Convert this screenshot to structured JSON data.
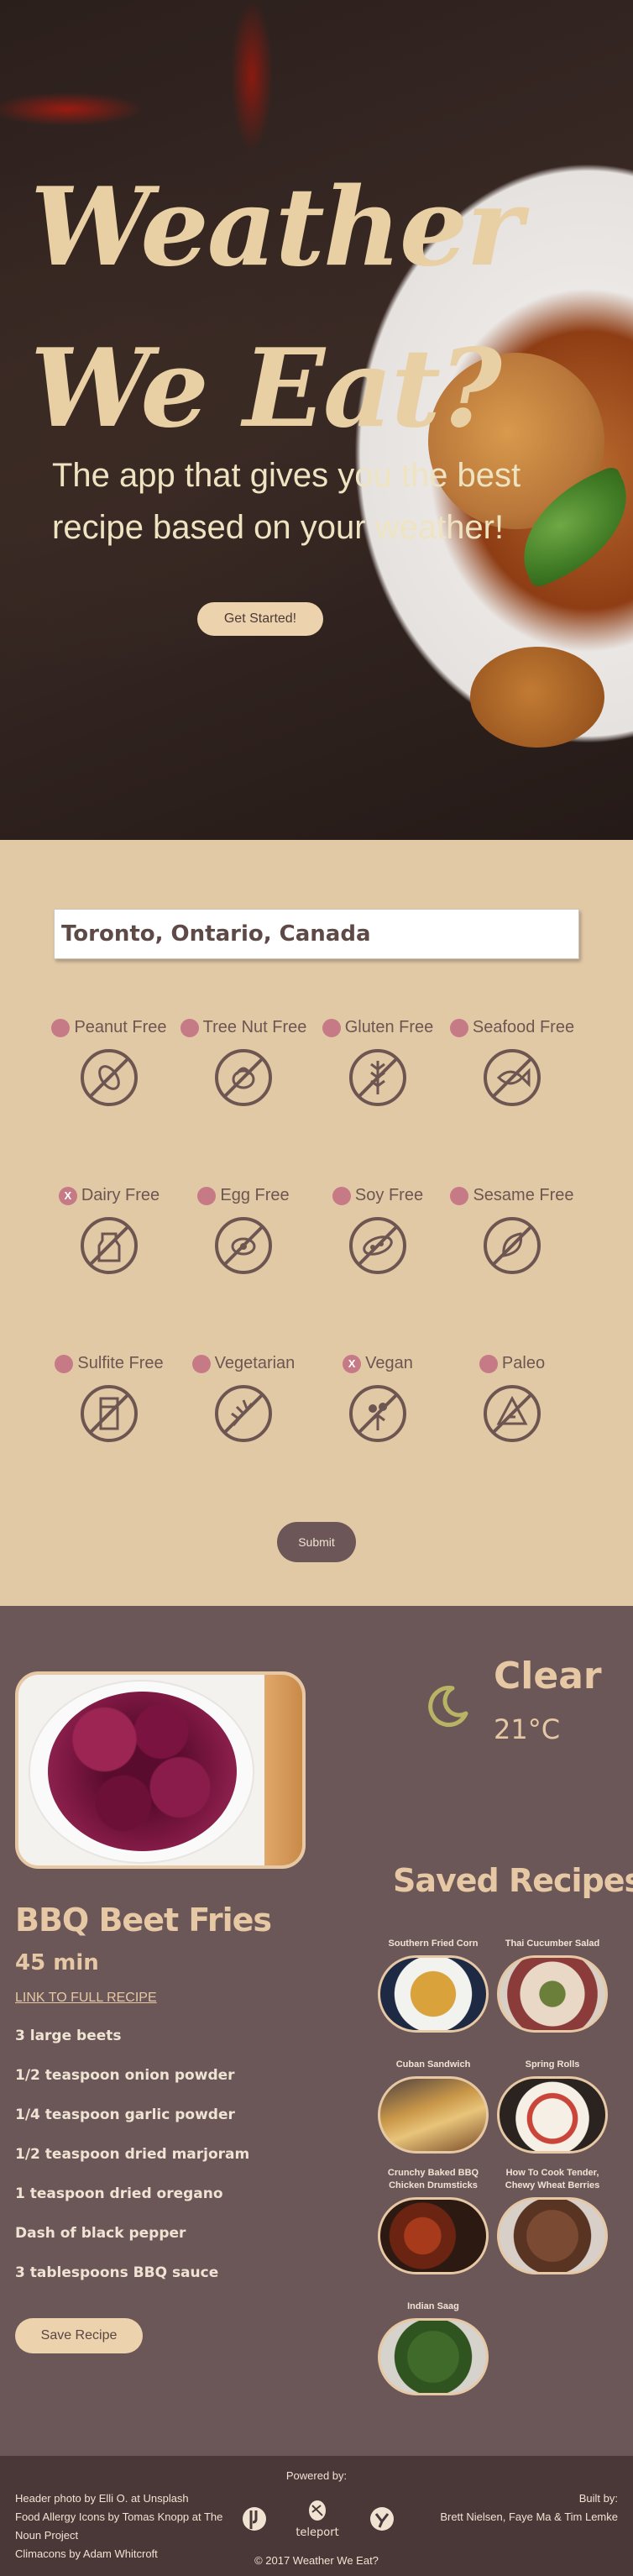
{
  "hero": {
    "title_line1": "Weather",
    "title_line2": "We Eat?",
    "subtitle": "The app that gives you the best recipe based on your weather!",
    "cta_label": "Get Started!"
  },
  "form": {
    "location_value": "Toronto, Ontario, Canada",
    "allergies": [
      {
        "label": "Peanut Free",
        "selected": false,
        "icon": "peanut-free-icon"
      },
      {
        "label": "Tree Nut Free",
        "selected": false,
        "icon": "tree-nut-free-icon"
      },
      {
        "label": "Gluten Free",
        "selected": false,
        "icon": "gluten-free-icon"
      },
      {
        "label": "Seafood Free",
        "selected": false,
        "icon": "seafood-free-icon"
      },
      {
        "label": "Dairy Free",
        "selected": true,
        "icon": "dairy-free-icon"
      },
      {
        "label": "Egg Free",
        "selected": false,
        "icon": "egg-free-icon"
      },
      {
        "label": "Soy Free",
        "selected": false,
        "icon": "soy-free-icon"
      },
      {
        "label": "Sesame Free",
        "selected": false,
        "icon": "sesame-free-icon"
      },
      {
        "label": "Sulfite Free",
        "selected": false,
        "icon": "sulfite-free-icon"
      },
      {
        "label": "Vegetarian",
        "selected": false,
        "icon": "vegetarian-icon"
      },
      {
        "label": "Vegan",
        "selected": true,
        "icon": "vegan-icon"
      },
      {
        "label": "Paleo",
        "selected": false,
        "icon": "paleo-icon"
      }
    ],
    "selected_mark": "X",
    "submit_label": "Submit"
  },
  "weather": {
    "condition": "Clear",
    "temperature": "21°C",
    "icon": "moon-icon"
  },
  "recipe": {
    "title": "BBQ Beet Fries",
    "time": "45 min",
    "link_label": "LINK TO FULL RECIPE",
    "ingredients": [
      "3 large beets",
      "1/2 teaspoon onion powder",
      "1/4 teaspoon garlic powder",
      "1/2 teaspoon dried marjoram",
      "1 teaspoon dried oregano",
      "Dash of black pepper",
      "3 tablespoons BBQ sauce"
    ],
    "save_label": "Save Recipe"
  },
  "saved": {
    "title": "Saved Recipes",
    "items": [
      {
        "name": "Southern Fried Corn"
      },
      {
        "name": "Thai Cucumber Salad"
      },
      {
        "name": "Cuban Sandwich"
      },
      {
        "name": "Spring Rolls"
      },
      {
        "name": "Crunchy Baked BBQ Chicken Drumsticks"
      },
      {
        "name": "How To Cook Tender, Chewy Wheat Berries"
      },
      {
        "name": "Indian Saag"
      }
    ]
  },
  "footer": {
    "credit1": "Header photo by Elli O. at Unsplash",
    "credit2": "Food Allergy Icons by Tomas Knopp at The",
    "credit3": "Noun Project",
    "credit4": "Climacons by Adam Whitcroft",
    "powered_by": "Powered by:",
    "partner_label": "teleport",
    "copyright": "© 2017 Weather We Eat?",
    "built_by_label": "Built by:",
    "built_by_names": "Brett Nielsen, Faye Ma & Tim Lemke"
  },
  "colors": {
    "tan": "#e2c9a6",
    "plum": "#6c5758",
    "footer": "#4a3738",
    "pink_dot": "#c67a86",
    "icon_stroke": "#6d5651"
  }
}
